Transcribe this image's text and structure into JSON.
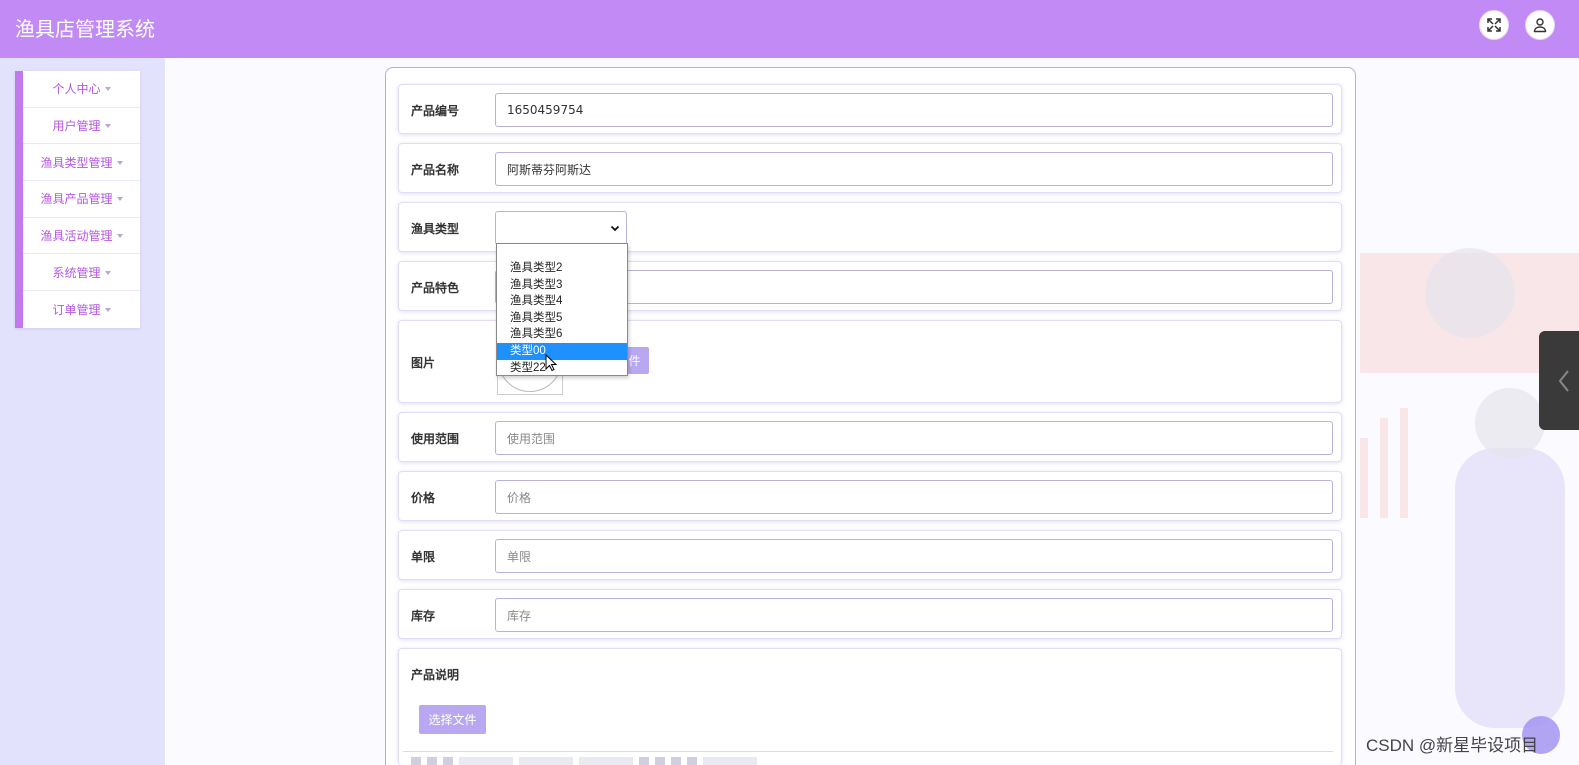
{
  "app": {
    "title": "渔具店管理系统"
  },
  "header": {
    "fullscreen_icon": "expand-icon",
    "user_icon": "user-icon"
  },
  "sidebar": {
    "items": [
      {
        "label": "个人中心"
      },
      {
        "label": "用户管理"
      },
      {
        "label": "渔具类型管理"
      },
      {
        "label": "渔具产品管理"
      },
      {
        "label": "渔具活动管理"
      },
      {
        "label": "系统管理"
      },
      {
        "label": "订单管理"
      }
    ]
  },
  "form": {
    "product_no": {
      "label": "产品编号",
      "value": "1650459754"
    },
    "product_name": {
      "label": "产品名称",
      "value": "阿斯蒂芬阿斯达"
    },
    "gear_type": {
      "label": "渔具类型",
      "value": ""
    },
    "feature": {
      "label": "产品特色",
      "value": ""
    },
    "image": {
      "label": "图片",
      "upload_label_partial": "件"
    },
    "scope": {
      "label": "使用范围",
      "placeholder": "使用范围"
    },
    "price": {
      "label": "价格",
      "placeholder": "价格"
    },
    "limit": {
      "label": "单限",
      "placeholder": "单限"
    },
    "stock": {
      "label": "库存",
      "placeholder": "库存"
    },
    "description": {
      "label": "产品说明",
      "upload_label": "选择文件"
    }
  },
  "dropdown": {
    "options": [
      "渔具类型2",
      "渔具类型3",
      "渔具类型4",
      "渔具类型5",
      "渔具类型6",
      "类型00",
      "类型22"
    ],
    "selected": "类型00"
  },
  "watermark": "CSDN @新星毕设项目",
  "colors": {
    "header": "#c18af4",
    "accent": "#b558e4",
    "selected_option": "#1e90ff",
    "upload_button": "#b9a7f2"
  }
}
